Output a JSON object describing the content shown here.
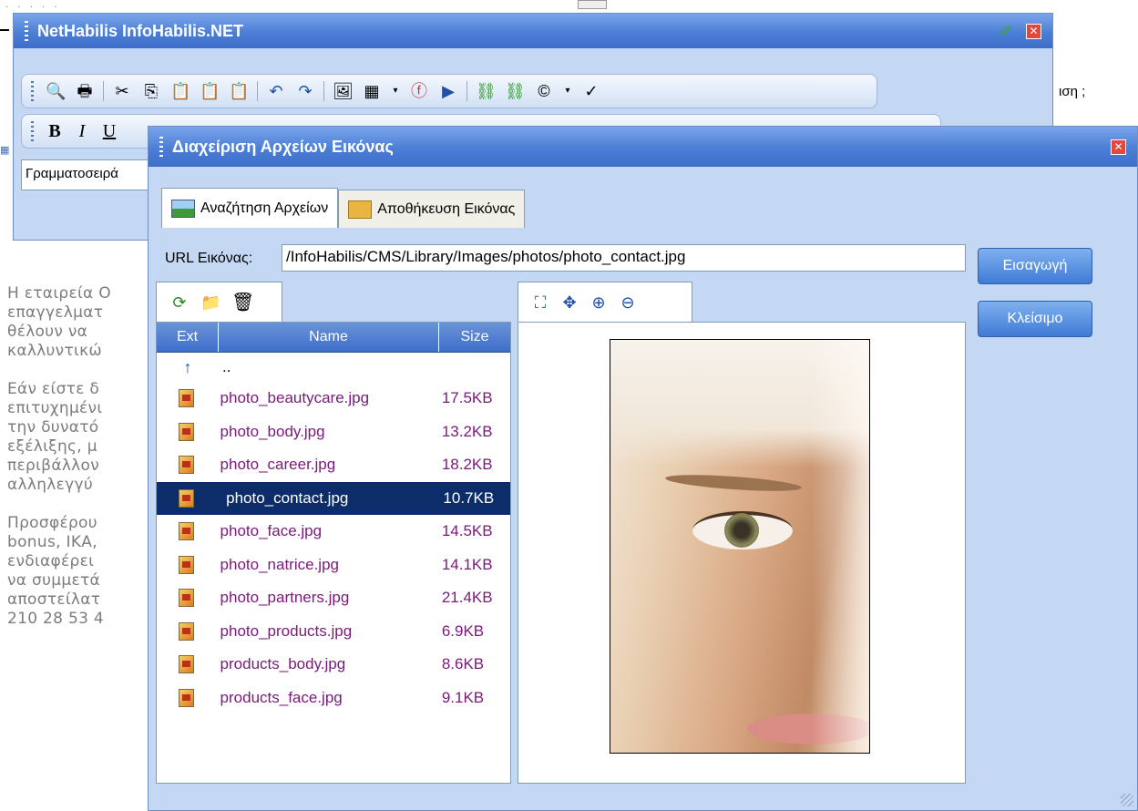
{
  "background_page": {
    "right_text": "ιση ;",
    "paragraphs": [
      [
        "Η εταιρεία Ο",
        "επαγγελματ",
        "θέλουν να",
        "καλλυντικώ"
      ],
      [
        "Εάν είστε δ",
        "επιτυχημένι",
        "την δυνατό",
        "εξέλιξης, μ",
        "περιβάλλον",
        "αλληλεγγύ"
      ],
      [
        "Προσφέρου",
        "bonus, ΙΚΑ,",
        "ενδιαφέρει",
        "να συμμετά",
        "αποστείλατ",
        "210 28 53 4"
      ]
    ]
  },
  "editor": {
    "title": "NetHabilis InfoHabilis.NET",
    "toolbar1_icons": [
      "find-icon",
      "print-icon",
      "cut-icon",
      "copy-icon",
      "paste-icon",
      "paste-word-icon",
      "paste-text-icon",
      "undo-icon",
      "redo-icon",
      "image-icon",
      "table-icon",
      "flash-icon",
      "media-icon",
      "link-icon",
      "unlink-icon",
      "symbol-icon",
      "spellcheck-icon"
    ],
    "format_buttons": {
      "bold": "B",
      "italic": "I",
      "underline": "U"
    },
    "font_select": "Γραμματοσειρά"
  },
  "dialog": {
    "title": "Διαχείριση Αρχείων Εικόνας",
    "tabs": [
      {
        "label": "Αναζήτηση Αρχείων",
        "active": true
      },
      {
        "label": "Αποθήκευση Εικόνας",
        "active": false
      }
    ],
    "url_label": "URL Εικόνας:",
    "url_value": "/InfoHabilis/CMS/Library/Images/photos/photo_contact.jpg",
    "insert_button": "Εισαγωγή",
    "close_button": "Κλείσιμο",
    "file_columns": {
      "ext": "Ext",
      "name": "Name",
      "size": "Size"
    },
    "parent_dir": "..",
    "files": [
      {
        "name": "photo_beautycare.jpg",
        "size": "17.5KB"
      },
      {
        "name": "photo_body.jpg",
        "size": "13.2KB"
      },
      {
        "name": "photo_career.jpg",
        "size": "18.2KB"
      },
      {
        "name": "photo_contact.jpg",
        "size": "10.7KB",
        "selected": true
      },
      {
        "name": "photo_face.jpg",
        "size": "14.5KB"
      },
      {
        "name": "photo_natrice.jpg",
        "size": "14.1KB"
      },
      {
        "name": "photo_partners.jpg",
        "size": "21.4KB"
      },
      {
        "name": "photo_products.jpg",
        "size": "6.9KB"
      },
      {
        "name": "products_body.jpg",
        "size": "8.6KB"
      },
      {
        "name": "products_face.jpg",
        "size": "9.1KB"
      }
    ],
    "browser_tools": [
      "refresh-icon",
      "new-folder-icon",
      "delete-icon"
    ],
    "preview_tools": [
      "fit-icon",
      "actual-size-icon",
      "zoom-in-icon",
      "zoom-out-icon"
    ]
  },
  "colors": {
    "title_bar": "#4b7ed6",
    "dialog_bg": "#c5d8f3",
    "selected_row": "#0d2d6a",
    "file_text": "#7a1a7a"
  }
}
